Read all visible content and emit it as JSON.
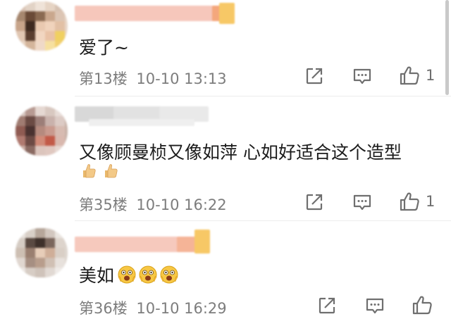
{
  "comments": [
    {
      "text": "爱了~",
      "floor": "第13楼",
      "time": "10-10 13:13",
      "like_count": "1"
    },
    {
      "text": "又像顾曼桢又像如萍 心如好适合这个造型",
      "floor": "第35楼",
      "time": "10-10 16:22",
      "like_count": "1"
    },
    {
      "text": "美如",
      "floor": "第36楼",
      "time": "10-10 16:29",
      "like_count": ""
    }
  ],
  "icons": {
    "share": "share-icon",
    "reply": "comment-icon",
    "like": "thumbs-up-icon",
    "thumbs_emoji": "thumbs-up-emoji-icon",
    "scared_emoji": "scared-face-emoji-icon"
  },
  "colors": {
    "meta_text": "#7d7d7d",
    "divider": "#ececec",
    "username_blur": "#f4b6a8"
  }
}
